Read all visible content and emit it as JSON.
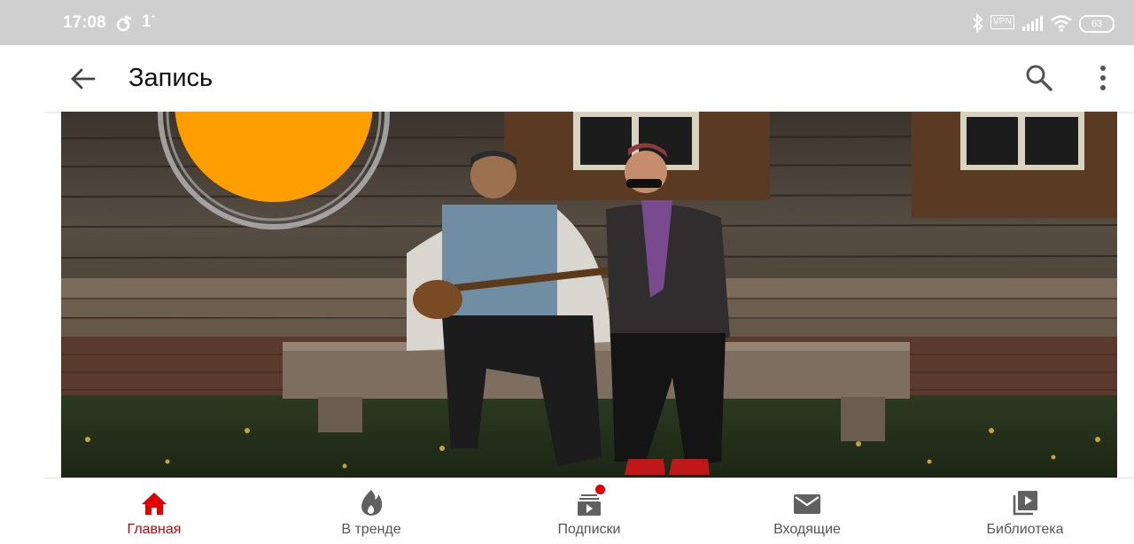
{
  "status_bar": {
    "time": "17:08",
    "notification_count": "1",
    "vpn_label": "VPN",
    "battery_level": "63"
  },
  "app_bar": {
    "title": "Запись",
    "back_icon": "arrow-back-icon",
    "search_icon": "search-icon",
    "more_icon": "more-vert-icon"
  },
  "post": {
    "image": "photo-two-men-on-bench"
  },
  "bottom_nav": {
    "items": [
      {
        "label": "Главная",
        "icon": "home-icon",
        "active": true
      },
      {
        "label": "В тренде",
        "icon": "flame-icon",
        "active": false
      },
      {
        "label": "Подписки",
        "icon": "subscriptions-icon",
        "active": false,
        "badge": true
      },
      {
        "label": "Входящие",
        "icon": "mail-icon",
        "active": false
      },
      {
        "label": "Библиотека",
        "icon": "library-icon",
        "active": false
      }
    ]
  },
  "colors": {
    "status_bar_bg": "#cfcfcf",
    "accent_red": "#cc0000",
    "icon_grey": "#606060"
  }
}
